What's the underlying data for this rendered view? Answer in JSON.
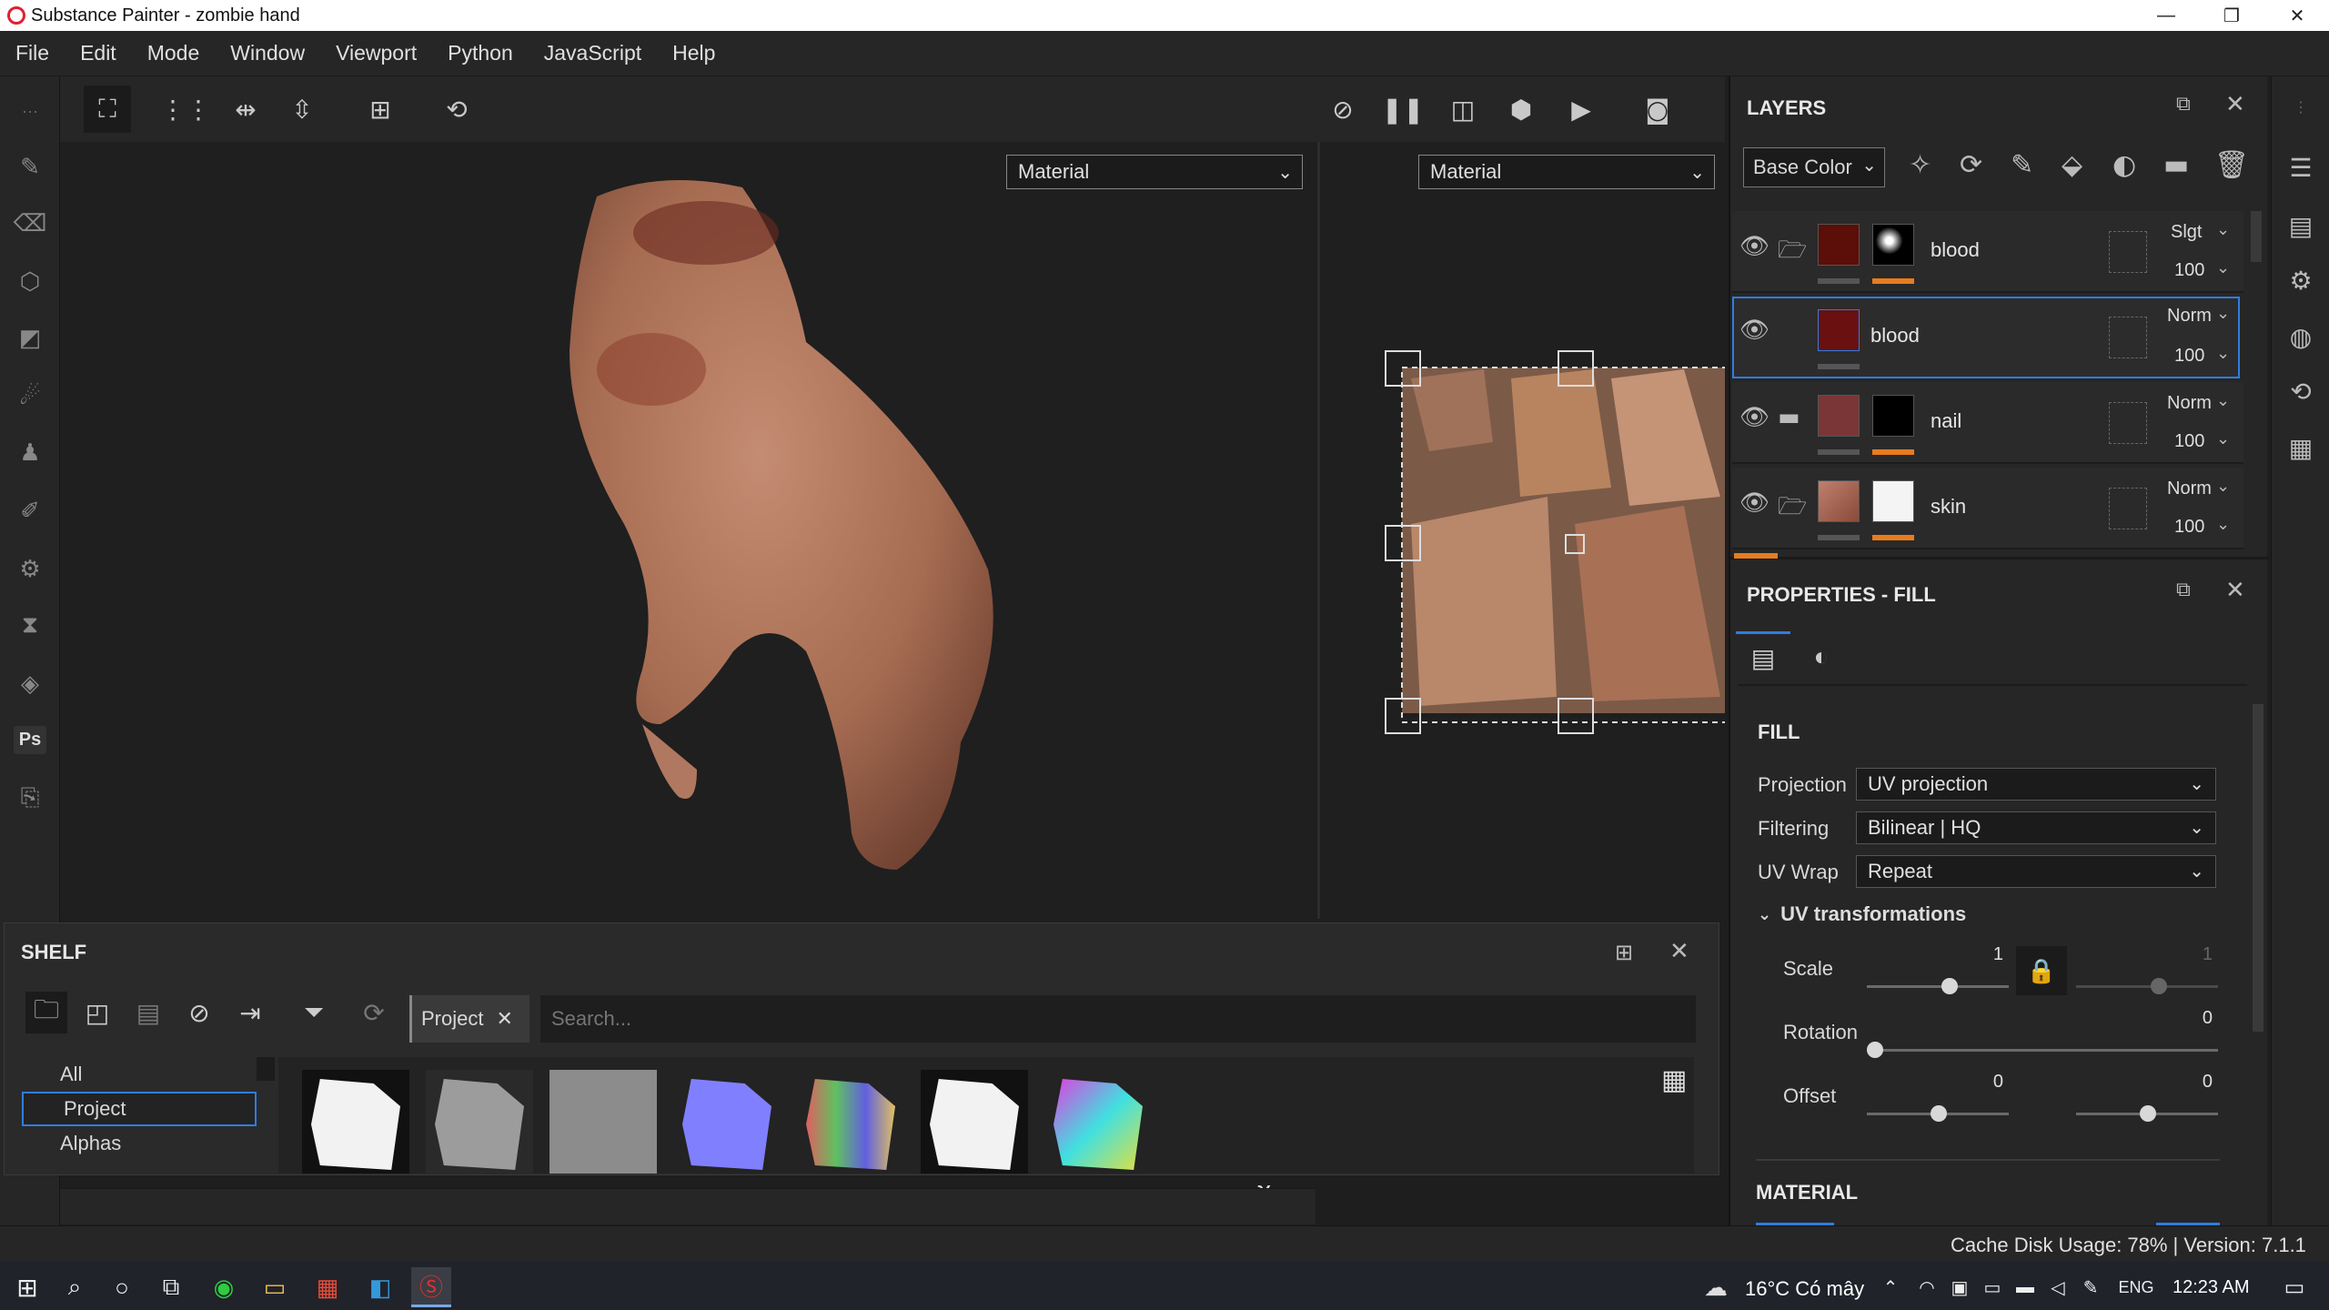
{
  "window": {
    "title": "Substance Painter - zombie hand"
  },
  "menu": [
    "File",
    "Edit",
    "Mode",
    "Window",
    "Viewport",
    "Python",
    "JavaScript",
    "Help"
  ],
  "viewport": {
    "left_mode": "Material",
    "right_mode": "Material"
  },
  "layers_panel": {
    "title": "LAYERS",
    "channel": "Base Color",
    "layers": [
      {
        "name": "blood",
        "blend": "Slgt",
        "opacity": "100",
        "color": "#5c0e08",
        "selected": false
      },
      {
        "name": "blood",
        "blend": "Norm",
        "opacity": "100",
        "color": "#6a1010",
        "selected": true
      },
      {
        "name": "nail",
        "blend": "Norm",
        "opacity": "100",
        "color": "#7a3636",
        "selected": false
      },
      {
        "name": "skin",
        "blend": "Norm",
        "opacity": "100",
        "color": "#9b5a4a",
        "selected": false
      }
    ]
  },
  "properties_panel": {
    "title": "PROPERTIES - FILL",
    "section": "FILL",
    "projection_label": "Projection",
    "projection_value": "UV projection",
    "filtering_label": "Filtering",
    "filtering_value": "Bilinear | HQ",
    "uvwrap_label": "UV Wrap",
    "uvwrap_value": "Repeat",
    "uv_transforms_label": "UV transformations",
    "scale_label": "Scale",
    "scale_u": "1",
    "scale_v": "1",
    "rotation_label": "Rotation",
    "rotation_value": "0",
    "offset_label": "Offset",
    "offset_u": "0",
    "offset_v": "0",
    "material_label": "MATERIAL"
  },
  "shelf": {
    "title": "SHELF",
    "filter_tag": "Project",
    "search_placeholder": "Search...",
    "categories": [
      "All",
      "Project",
      "Alphas"
    ],
    "selected_category": "Project"
  },
  "status": {
    "cache": "Cache Disk Usage: 78% | Version: 7.1.1"
  },
  "taskbar": {
    "weather": "16°C  Có mây",
    "lang": "ENG",
    "time": "12:23 AM"
  },
  "colors": {
    "accent": "#2f7de1",
    "orange_bar": "#e87c1e",
    "bg": "#1f1f1f"
  }
}
